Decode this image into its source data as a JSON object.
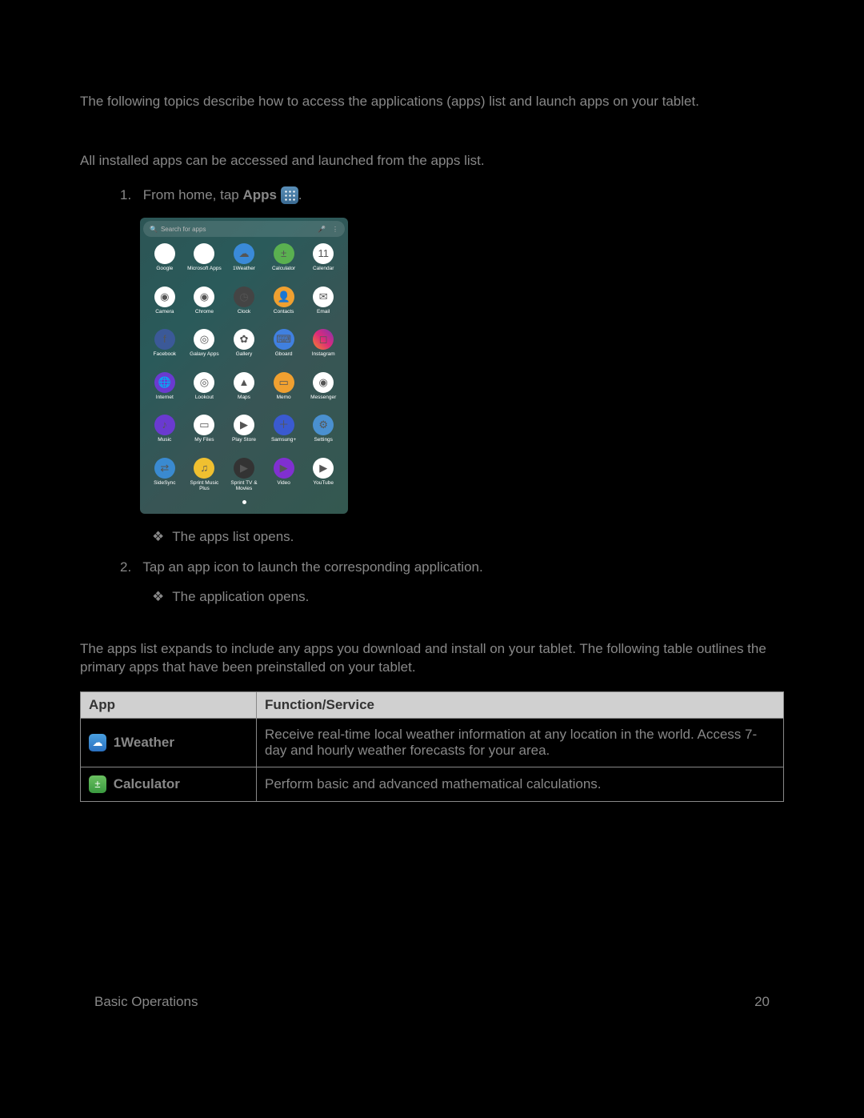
{
  "intro": "The following topics describe how to access the applications (apps) list and launch apps on your tablet.",
  "launch_intro": "All installed apps can be accessed and launched from the apps list.",
  "step1_prefix": "1.",
  "step1_text_a": "From home, tap ",
  "step1_bold": "Apps",
  "step1_trailing_period": ".",
  "sub1": "The apps list opens.",
  "step2_prefix": "2.",
  "step2_text": "Tap an app icon to launch the corresponding application.",
  "sub2": "The application opens.",
  "apps_list_intro": "The apps list expands to include any apps you download and install on your tablet. The following table outlines the primary apps that have been preinstalled on your tablet.",
  "table_headers": {
    "app": "App",
    "function": "Function/Service"
  },
  "table_rows": [
    {
      "icon_glyph": "☁",
      "icon_class": "weather-bg",
      "name": "1Weather",
      "function": "Receive real-time local weather information at any location in the world. Access 7-day and hourly weather forecasts for your area."
    },
    {
      "icon_glyph": "±",
      "icon_class": "calc-bg",
      "name": "Calculator",
      "function": "Perform basic and advanced mathematical calculations."
    }
  ],
  "footer_left": "Basic Operations",
  "footer_right": "20",
  "screenshot": {
    "search_placeholder": "Search for apps",
    "apps": [
      {
        "label": "Google",
        "bg": "#fff",
        "glyph": ""
      },
      {
        "label": "Microsoft Apps",
        "bg": "#fff",
        "glyph": ""
      },
      {
        "label": "1Weather",
        "bg": "#3a8ad8",
        "glyph": "☁"
      },
      {
        "label": "Calculator",
        "bg": "#5ab050",
        "glyph": "±"
      },
      {
        "label": "Calendar",
        "bg": "#fff",
        "glyph": "11"
      },
      {
        "label": "Camera",
        "bg": "#fff",
        "glyph": "◉"
      },
      {
        "label": "Chrome",
        "bg": "#fff",
        "glyph": "◉"
      },
      {
        "label": "Clock",
        "bg": "#444",
        "glyph": "◷"
      },
      {
        "label": "Contacts",
        "bg": "#f0a030",
        "glyph": "👤"
      },
      {
        "label": "Email",
        "bg": "#fff",
        "glyph": "✉"
      },
      {
        "label": "Facebook",
        "bg": "#3b5998",
        "glyph": "f"
      },
      {
        "label": "Galaxy Apps",
        "bg": "#fff",
        "glyph": "◎"
      },
      {
        "label": "Gallery",
        "bg": "#fff",
        "glyph": "✿"
      },
      {
        "label": "Gboard",
        "bg": "#4080e0",
        "glyph": "⌨"
      },
      {
        "label": "Instagram",
        "bg": "linear-gradient(45deg,#f58529,#dd2a7b,#8134af)",
        "glyph": "◻"
      },
      {
        "label": "Internet",
        "bg": "#6a3ad0",
        "glyph": "🌐"
      },
      {
        "label": "Lookout",
        "bg": "#fff",
        "glyph": "◎"
      },
      {
        "label": "Maps",
        "bg": "#fff",
        "glyph": "▲"
      },
      {
        "label": "Memo",
        "bg": "#f0a030",
        "glyph": "▭"
      },
      {
        "label": "Messenger",
        "bg": "#fff",
        "glyph": "◉"
      },
      {
        "label": "Music",
        "bg": "#6a3ad0",
        "glyph": "♪"
      },
      {
        "label": "My Files",
        "bg": "#fff",
        "glyph": "▭"
      },
      {
        "label": "Play Store",
        "bg": "#fff",
        "glyph": "▶"
      },
      {
        "label": "Samsung+",
        "bg": "#3a5ad0",
        "glyph": "＋"
      },
      {
        "label": "Settings",
        "bg": "#4a90d0",
        "glyph": "⚙"
      },
      {
        "label": "SideSync",
        "bg": "#3a8ad0",
        "glyph": "⇄"
      },
      {
        "label": "Sprint Music Plus",
        "bg": "#f0c030",
        "glyph": "♫"
      },
      {
        "label": "Sprint TV & Movies",
        "bg": "#333",
        "glyph": "▶"
      },
      {
        "label": "Video",
        "bg": "#8030d0",
        "glyph": "▶"
      },
      {
        "label": "YouTube",
        "bg": "#fff",
        "glyph": "▶"
      }
    ]
  }
}
